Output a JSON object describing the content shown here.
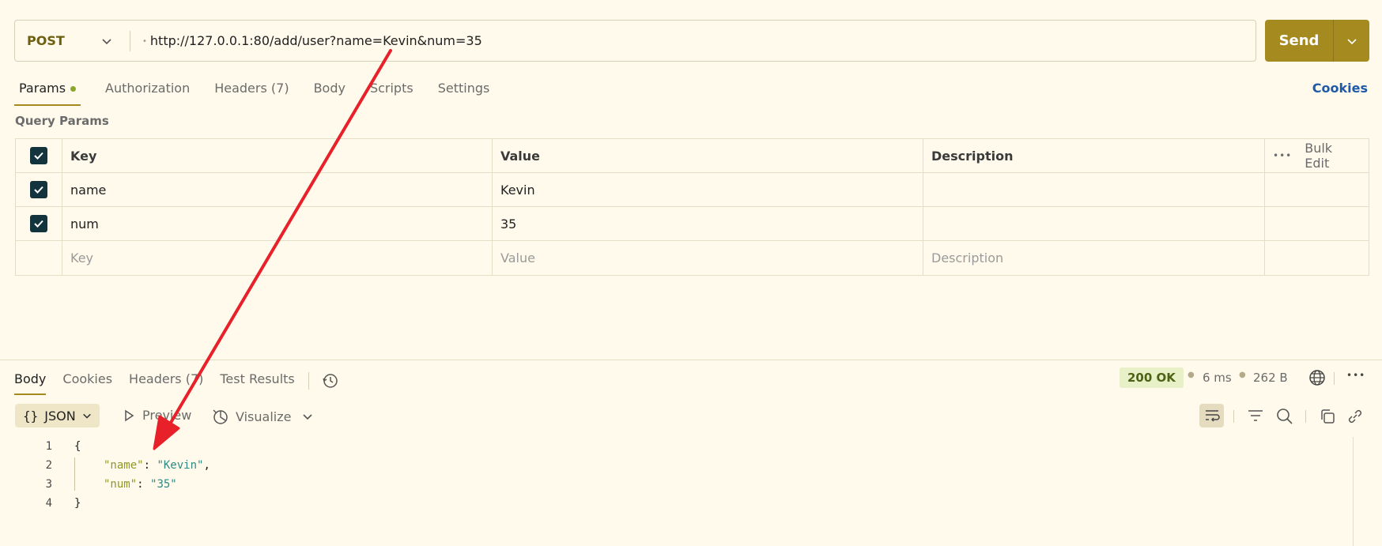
{
  "request": {
    "method": "POST",
    "url": "http://127.0.0.1:80/add/user?name=Kevin&num=35",
    "send_label": "Send"
  },
  "request_tabs": {
    "params": "Params",
    "authorization": "Authorization",
    "headers": "Headers (7)",
    "body": "Body",
    "scripts": "Scripts",
    "settings": "Settings",
    "cookies": "Cookies"
  },
  "query_params": {
    "label": "Query Params",
    "columns": {
      "key": "Key",
      "value": "Value",
      "description": "Description",
      "bulk_edit": "Bulk Edit"
    },
    "rows": [
      {
        "key": "name",
        "value": "Kevin",
        "checked": true
      },
      {
        "key": "num",
        "value": "35",
        "checked": true
      }
    ],
    "placeholders": {
      "key": "Key",
      "value": "Value",
      "description": "Description"
    }
  },
  "response_tabs": {
    "body": "Body",
    "cookies": "Cookies",
    "headers": "Headers (7)",
    "test_results": "Test Results"
  },
  "response_meta": {
    "status": "200 OK",
    "time": "6 ms",
    "size": "262 B"
  },
  "response_toolbar": {
    "format": "JSON",
    "preview": "Preview",
    "visualize": "Visualize"
  },
  "response_body": {
    "line_numbers": [
      "1",
      "2",
      "3",
      "4"
    ],
    "open_brace": "{",
    "name_key": "\"name\"",
    "name_value": "\"Kevin\"",
    "num_key": "\"num\"",
    "num_value": "\"35\"",
    "close_brace": "}"
  },
  "colors": {
    "background": "#fffaeb",
    "send_button": "#a58a1f",
    "status_ok_bg": "#e8f0c8",
    "annotation_arrow": "#e8202a",
    "link": "#1e5aa8"
  },
  "icons": [
    "chevron-down-icon",
    "checkbox-checked-icon",
    "more-dots-icon",
    "history-icon",
    "play-icon",
    "visualize-icon",
    "globe-icon",
    "wrap-lines-icon",
    "filter-icon",
    "search-icon",
    "copy-icon",
    "link-icon"
  ]
}
